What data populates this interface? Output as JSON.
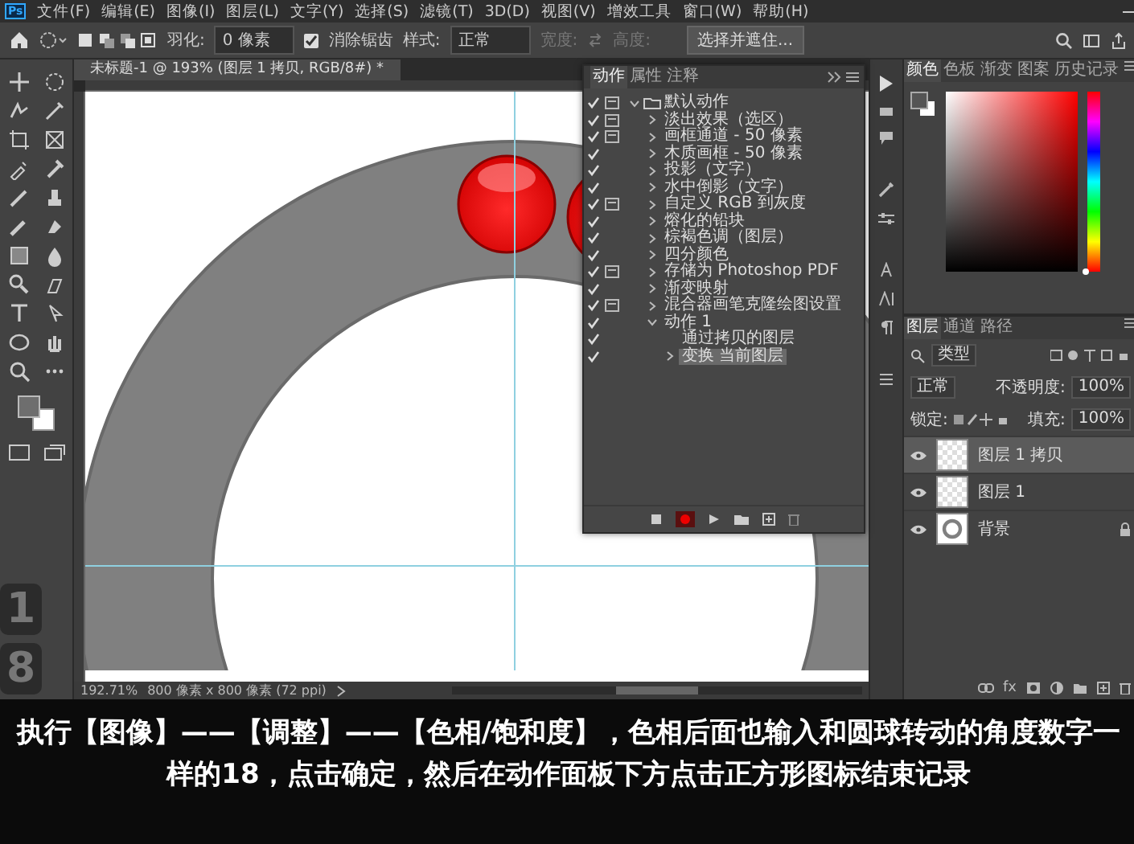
{
  "menu_bar": {
    "logo": "Ps",
    "items": [
      "文件(F)",
      "编辑(E)",
      "图像(I)",
      "图层(L)",
      "文字(Y)",
      "选择(S)",
      "滤镜(T)",
      "3D(D)",
      "视图(V)",
      "增效工具",
      "窗口(W)",
      "帮助(H)"
    ]
  },
  "options_bar": {
    "feather_label": "羽化:",
    "feather_value": "0 像素",
    "antialias": {
      "label": "消除锯齿",
      "checked": true
    },
    "style_label": "样式:",
    "style_value": "正常",
    "width_label": "宽度:",
    "height_label": "高度:",
    "select_mask_button": "选择并遮住..."
  },
  "document": {
    "tab": "未标题-1 @ 193% (图层 1 拷贝, RGB/8#) *",
    "zoom": "192.71%",
    "size": "800 像素 x 800 像素 (72 ppi)"
  },
  "overlay_digits": [
    "1",
    "8"
  ],
  "actions_panel": {
    "tabs": [
      {
        "label": "动作",
        "selected": true
      },
      {
        "label": "属性",
        "selected": false
      },
      {
        "label": "注释",
        "selected": false
      }
    ],
    "recording": true,
    "items": [
      {
        "label": "默认动作",
        "kind": "set",
        "checked": true,
        "dialog": true,
        "expanded": true,
        "selected": false,
        "children": [
          {
            "label": "淡出效果（选区）",
            "checked": true,
            "dialog": true,
            "expanded": false,
            "selected": false
          },
          {
            "label": "画框通道 - 50 像素",
            "checked": true,
            "dialog": true,
            "expanded": false,
            "selected": false
          },
          {
            "label": "木质画框 - 50 像素",
            "checked": true,
            "dialog": false,
            "expanded": false,
            "selected": false
          },
          {
            "label": "投影（文字）",
            "checked": true,
            "dialog": false,
            "expanded": false,
            "selected": false
          },
          {
            "label": "水中倒影（文字）",
            "checked": true,
            "dialog": false,
            "expanded": false,
            "selected": false
          },
          {
            "label": "自定义 RGB 到灰度",
            "checked": true,
            "dialog": true,
            "expanded": false,
            "selected": false
          },
          {
            "label": "熔化的铅块",
            "checked": true,
            "dialog": false,
            "expanded": false,
            "selected": false
          },
          {
            "label": "棕褐色调（图层）",
            "checked": true,
            "dialog": false,
            "expanded": false,
            "selected": false
          },
          {
            "label": "四分颜色",
            "checked": true,
            "dialog": false,
            "expanded": false,
            "selected": false
          },
          {
            "label": "存储为 Photoshop PDF",
            "checked": true,
            "dialog": true,
            "expanded": false,
            "selected": false
          },
          {
            "label": "渐变映射",
            "checked": true,
            "dialog": false,
            "expanded": false,
            "selected": false
          },
          {
            "label": "混合器画笔克隆绘图设置",
            "checked": true,
            "dialog": true,
            "expanded": false,
            "selected": false
          },
          {
            "label": "动作 1",
            "checked": true,
            "dialog": false,
            "expanded": true,
            "selected": false,
            "children": [
              {
                "label": "通过拷贝的图层",
                "checked": true,
                "dialog": false,
                "selected": false
              },
              {
                "label": "变换 当前图层",
                "checked": true,
                "dialog": false,
                "expanded": false,
                "selected": true
              }
            ]
          }
        ]
      }
    ]
  },
  "color_panel": {
    "tabs": [
      {
        "label": "颜色",
        "selected": true
      },
      {
        "label": "色板",
        "selected": false
      },
      {
        "label": "渐变",
        "selected": false
      },
      {
        "label": "图案",
        "selected": false
      },
      {
        "label": "历史记录",
        "selected": false
      }
    ],
    "hue_slider": {
      "level": 0
    }
  },
  "layers_panel": {
    "tabs": [
      {
        "label": "图层",
        "selected": true
      },
      {
        "label": "通道",
        "selected": false
      },
      {
        "label": "路径",
        "selected": false
      }
    ],
    "filter": "类型",
    "blend_mode": "正常",
    "opacity_label": "不透明度:",
    "opacity": "100%",
    "lock_label": "锁定:",
    "fill_label": "填充:",
    "fill": "100%",
    "layers": [
      {
        "name": "图层 1 拷贝",
        "kind": "transparent",
        "visible": true,
        "selected": true,
        "locked": false
      },
      {
        "name": "图层 1",
        "kind": "transparent",
        "visible": true,
        "selected": false,
        "locked": false
      },
      {
        "name": "背景",
        "kind": "ring",
        "visible": true,
        "selected": false,
        "locked": true
      }
    ],
    "fx_label": "fx"
  },
  "caption": "执行【图像】——【调整】——【色相/饱和度】，色相后面也输入和圆球转动的角度数字一样的18，点击确定，然后在动作面板下方点击正方形图标结束记录"
}
